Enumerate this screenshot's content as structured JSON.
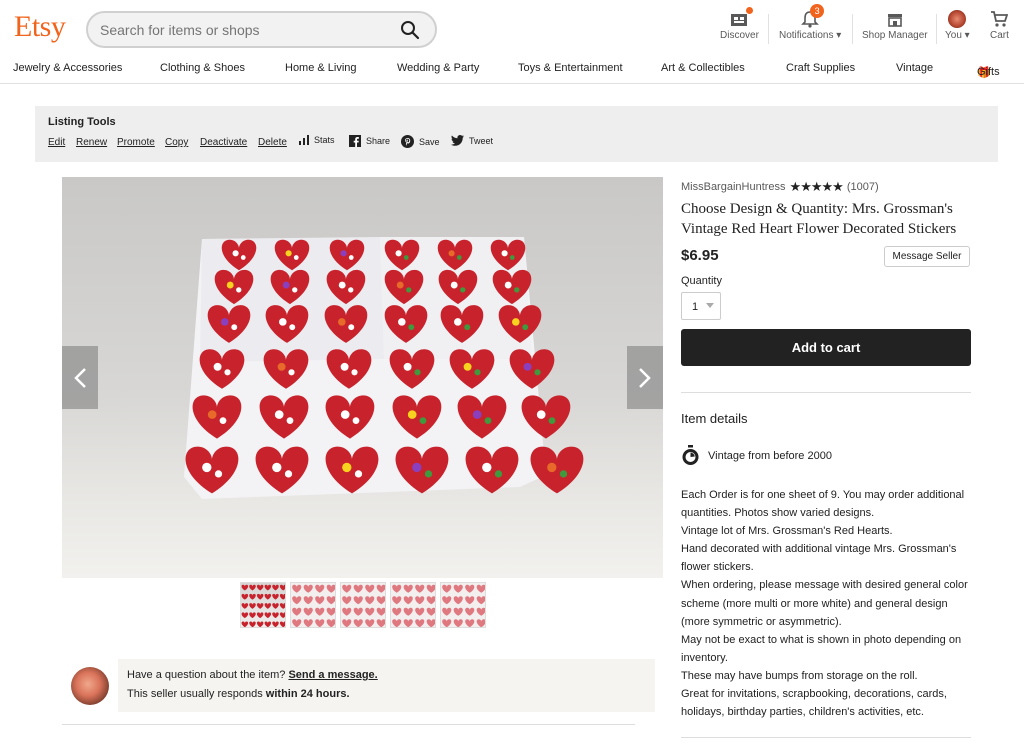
{
  "header": {
    "logo": "Etsy",
    "search_placeholder": "Search for items or shops",
    "nav": {
      "discover": "Discover",
      "notifications": "Notifications",
      "notifications_count": "3",
      "shop_manager": "Shop Manager",
      "you": "You",
      "cart": "Cart"
    }
  },
  "categories": [
    "Jewelry & Accessories",
    "Clothing & Shoes",
    "Home & Living",
    "Wedding & Party",
    "Toys & Entertainment",
    "Art & Collectibles",
    "Craft Supplies",
    "Vintage",
    "Gifts"
  ],
  "listing_tools": {
    "title": "Listing Tools",
    "links": [
      "Edit",
      "Renew",
      "Promote",
      "Copy",
      "Deactivate",
      "Delete"
    ],
    "stats": "Stats",
    "share": "Share",
    "save": "Save",
    "tweet": "Tweet"
  },
  "listing": {
    "shop_name": "MissBargainHuntress",
    "rating_stars": 5,
    "review_count": "(1007)",
    "title": "Choose Design & Quantity: Mrs. Grossman's Vintage Red Heart Flower Decorated Stickers",
    "price": "$6.95",
    "message_seller": "Message Seller",
    "quantity_label": "Quantity",
    "quantity_value": "1",
    "add_to_cart": "Add to cart",
    "item_details": "Item details",
    "vintage": "Vintage from before 2000",
    "description": [
      "Each Order is for one sheet of 9. You may order additional quantities. Photos show varied designs.",
      "Vintage lot of Mrs. Grossman's Red Hearts.",
      "Hand decorated with additional vintage Mrs. Grossman's flower stickers.",
      "When ordering, please message with desired general color scheme (more multi or more white) and general design (more symmetric or asymmetric).",
      "May not be exact to what is shown in photo depending on inventory.",
      "These may have bumps from storage on the roll.",
      "Great for invitations, scrapbooking, decorations, cards, holidays, birthday parties, children's activities, etc."
    ]
  },
  "ask": {
    "question": "Have a question about the item?",
    "link": "Send a message.",
    "responds_prefix": "This seller usually responds",
    "responds_time": "within 24 hours."
  },
  "colors": {
    "brand": "#f1641e",
    "heart": "#c8232c",
    "button": "#222222"
  }
}
